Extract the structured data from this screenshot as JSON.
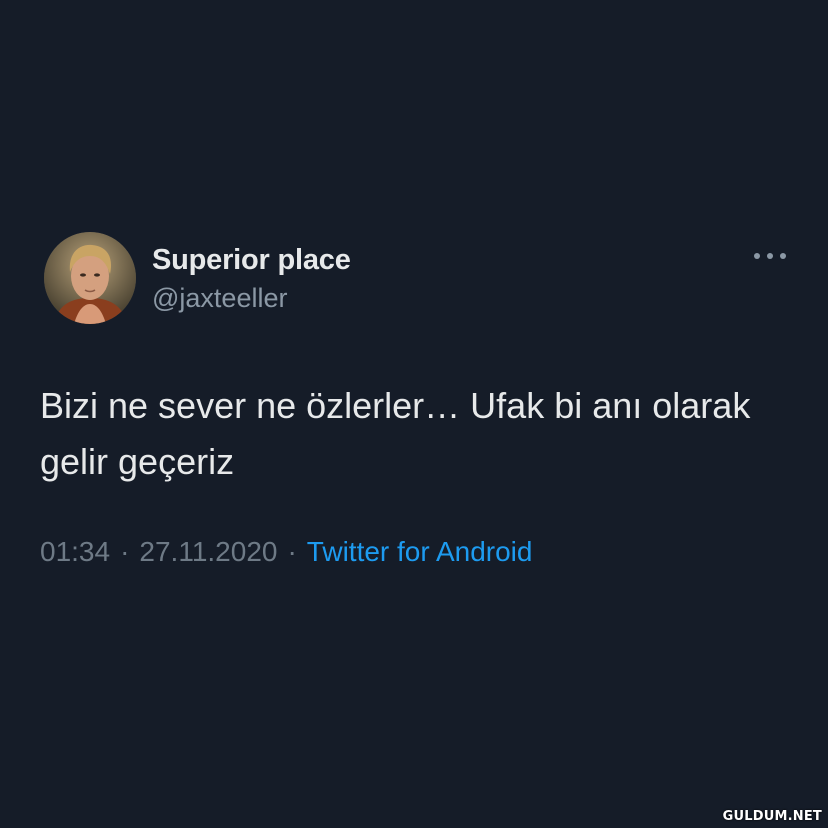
{
  "author": {
    "display_name": "Superior place",
    "handle": "@jaxteeller",
    "avatar": "avatar-photo"
  },
  "tweet": {
    "text": "Bizi ne sever ne özlerler… Ufak bi anı olarak gelir geçeriz",
    "time": "01:34",
    "date": "27.11.2020",
    "separator": "·",
    "source": "Twitter for Android"
  },
  "icons": {
    "more": "more-horizontal-icon"
  },
  "colors": {
    "background": "#151c28",
    "text": "#e7e9ea",
    "secondary_text": "#8b98a5",
    "link": "#1d9bf0"
  },
  "watermark": "GULDUM.NET"
}
